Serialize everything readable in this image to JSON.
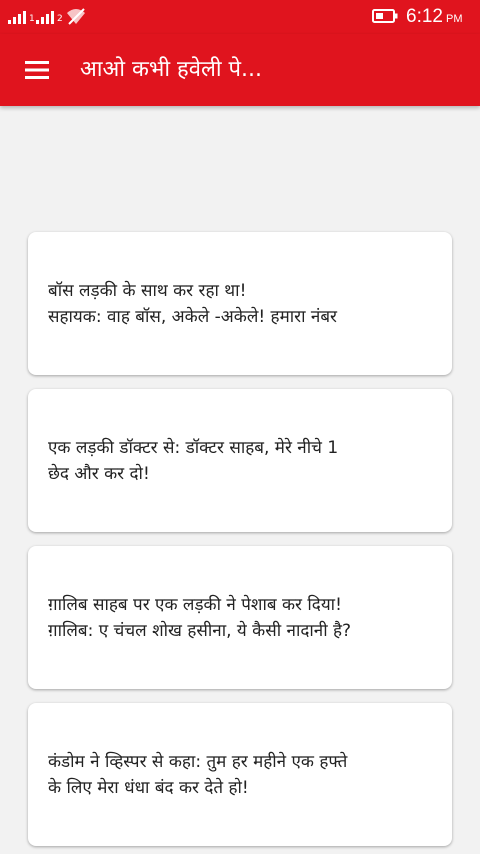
{
  "status_bar": {
    "time": "6:12",
    "ampm": "PM",
    "sim1_label": "1",
    "sim2_label": "2"
  },
  "app_bar": {
    "title": "आओ कभी हवेली पे..."
  },
  "jokes": [
    "बॉस लड़की के साथ कर रहा था!\nसहायक: वाह बॉस, अकेले -अकेले! हमारा नंबर",
    "एक लड़की डॉक्टर से: डॉक्टर साहब, मेरे नीचे 1\nछेद और कर दो!",
    "ग़ालिब साहब पर एक लड़की ने पेशाब कर दिया!\nग़ालिब: ए चंचल शोख हसीना, ये कैसी नादानी है?",
    "कंडोम ने व्हिस्पर से कहा: तुम हर महीने एक हफ्ते\nके लिए मेरा धंधा बंद कर देते हो!"
  ],
  "colors": {
    "accent": "#e0141e",
    "background": "#f2f2f2",
    "card": "#ffffff",
    "text": "#222222"
  },
  "icons": {
    "menu": "menu-icon",
    "signal": "signal-icon",
    "wifi_off": "wifi-off-icon",
    "battery": "battery-icon"
  }
}
